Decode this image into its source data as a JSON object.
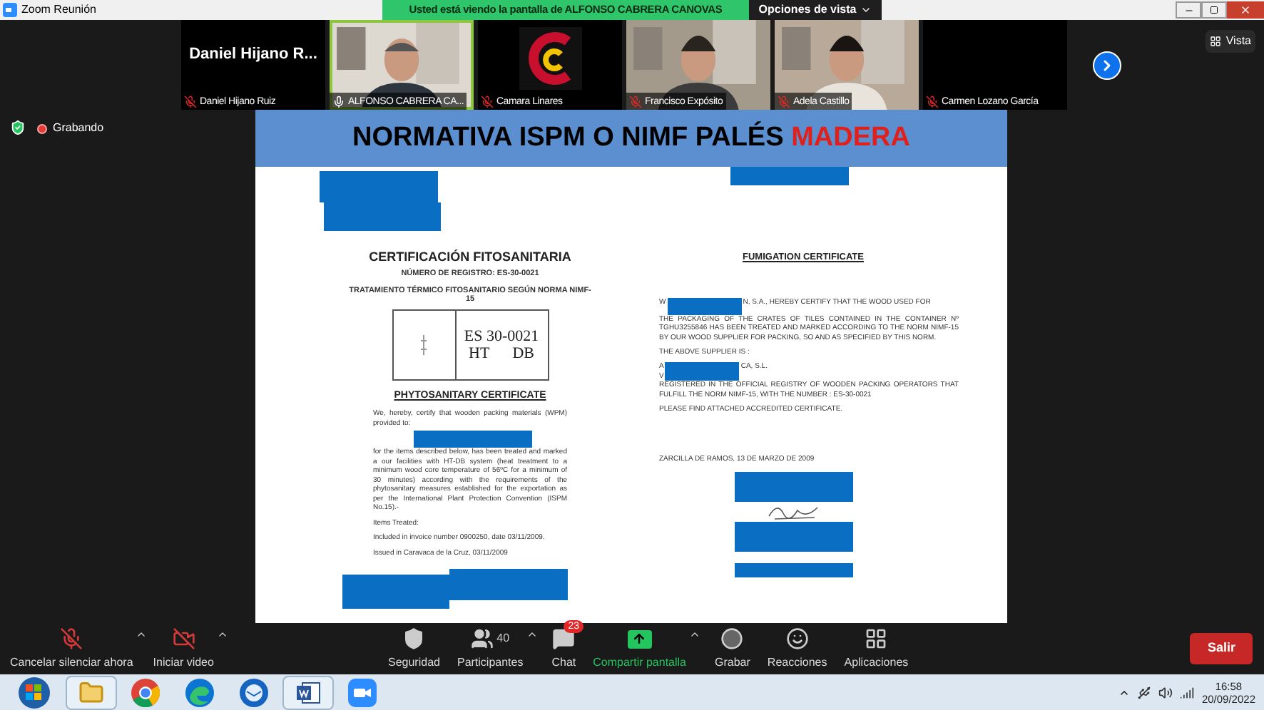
{
  "window": {
    "title": "Zoom Reunión"
  },
  "share_banner": {
    "text": "Usted está viendo la pantalla de ALFONSO CABRERA CANOVAS",
    "view_options": "Opciones de vista"
  },
  "participants": [
    {
      "kind": "name",
      "display": "Daniel Hijano R...",
      "name": "Daniel Hijano Ruiz",
      "muted": true,
      "selected": false
    },
    {
      "kind": "video",
      "name": "ALFONSO CABRERA CA...",
      "muted": false,
      "selected": true
    },
    {
      "kind": "logo",
      "name": "Camara Linares",
      "muted": true,
      "selected": false
    },
    {
      "kind": "video",
      "name": "Francisco Expósito",
      "muted": true,
      "selected": false
    },
    {
      "kind": "video",
      "name": "Adela Castillo",
      "muted": true,
      "selected": false
    },
    {
      "kind": "blank",
      "name": "Carmen Lozano García",
      "muted": true,
      "selected": false
    }
  ],
  "view_button": "Vista",
  "recording": {
    "label": "Grabando"
  },
  "slide": {
    "title": "NORMATIVA ISPM O NIMF PALÉS",
    "title_highlight": "MADERA",
    "left_page": {
      "heading": "CERTIFICACIÓN  FITOSANITARIA",
      "registry": "NÚMERO DE REGISTRO: ES-30-0021",
      "treatment": "TRATAMIENTO TÉRMICO FITOSANITARIO SEGÚN NORMA NIMF-15",
      "stamp_code": "ES 30-0021",
      "stamp_marks": [
        "HT",
        "DB"
      ],
      "cert_title": "PHYTOSANITARY CERTIFICATE",
      "intro": "We, hereby, certify that wooden packing materials (WPM) provided to:",
      "body": "for the items described below, has been treated and marked a our facilities with HT-DB system (heat treatment to a minimum wood core temperature of 56ºC for a minimum of 30 minutes) according with the requirements of the phytosanitary measures established for the exportation as per the International Plant Protection Convention (ISPM No.15).-",
      "items_label": "Items Treated:",
      "invoice": "Included in invoice number 0900250, date 03/11/2009.",
      "issued": "Issued in Caravaca de la Cruz, 03/11/2009"
    },
    "right_page": {
      "heading": "FUMIGATION CERTIFICATE",
      "body_start": "W",
      "body_line1": "N, S.A., HEREBY CERTIFY THAT THE WOOD USED FOR",
      "body_rest": "THE PACKAGING OF THE CRATES OF TILES CONTAINED IN THE CONTAINER Nº TGHU3255846 HAS BEEN TREATED AND MARKED ACCORDING TO THE NORM NIMF-15 BY OUR WOOD SUPPLIER FOR PACKING, SO AND AS SPECIFIED BY THIS NORM.",
      "supplier_label": "THE ABOVE SUPPLIER IS :",
      "supplier_start": "A",
      "supplier_rest": "CA, S.L.",
      "supplier_line2": "V",
      "registered": "REGISTERED IN THE OFFICIAL REGISTRY OF WOODEN PACKING OPERATORS THAT FULFILL THE NORM NIMF-15, WITH THE NUMBER : ES-30-0021",
      "attached": "PLEASE FIND ATTACHED ACCREDITED CERTIFICATE.",
      "place_date": "ZARCILLA DE RAMOS, 13 DE MARZO DE 2009"
    }
  },
  "toolbar": [
    {
      "kind": "mic",
      "label": "Cancelar silenciar ahora",
      "off": true,
      "caret": true
    },
    {
      "kind": "video",
      "label": "Iniciar video",
      "off": true,
      "caret": true
    },
    {
      "kind": "security",
      "label": "Seguridad",
      "caret": false
    },
    {
      "kind": "participants",
      "label": "Participantes",
      "count": "40",
      "caret": true
    },
    {
      "kind": "chat",
      "label": "Chat",
      "badge": "23",
      "caret": false
    },
    {
      "kind": "share",
      "label": "Compartir pantalla",
      "caret": true
    },
    {
      "kind": "record",
      "label": "Grabar",
      "caret": false
    },
    {
      "kind": "reactions",
      "label": "Reacciones",
      "caret": false
    },
    {
      "kind": "apps",
      "label": "Aplicaciones",
      "caret": false
    }
  ],
  "leave_button": "Salir",
  "taskbar": {
    "apps": [
      {
        "kind": "start"
      },
      {
        "kind": "folder"
      },
      {
        "kind": "chrome"
      },
      {
        "kind": "edge"
      },
      {
        "kind": "mail"
      },
      {
        "kind": "word"
      },
      {
        "kind": "zoom"
      }
    ],
    "time": "16:58",
    "date": "20/09/2022"
  }
}
